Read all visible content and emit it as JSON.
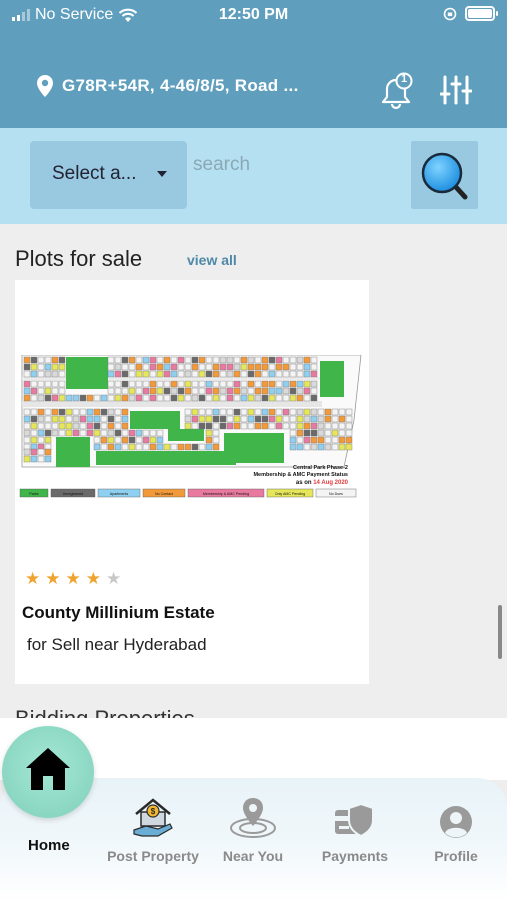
{
  "status_bar": {
    "carrier": "No Service",
    "time": "12:50 PM"
  },
  "header": {
    "location": "G78R+54R, 4-46/8/5, Road ...",
    "notification_count": "1",
    "bg_color": "#5f9fbd"
  },
  "search": {
    "select_label": "Select a...",
    "placeholder": "search"
  },
  "plots_section": {
    "title": "Plots for sale",
    "view_all": "view all"
  },
  "listing": {
    "image_caption": {
      "line1": "Central Park Phase-2",
      "line2": "Membership & AMC Payment Status",
      "line3_prefix": "as on ",
      "line3_date": "14 Aug 2020"
    },
    "image_legend": [
      "Parks",
      "Unregistered",
      "Apartments",
      "No Contact",
      "Membership & AMC Pending",
      "Only AMC Pending",
      "No Dues"
    ],
    "rating": 4,
    "rating_max": 5,
    "title": "County Millinium Estate",
    "subtitle": "for Sell near Hyderabad"
  },
  "next_section": {
    "title": "Bidding Properties"
  },
  "bottom_nav": {
    "active": "Home",
    "items": [
      {
        "label": "Home",
        "icon": "home-icon"
      },
      {
        "label": "Post Property",
        "icon": "post-property-icon"
      },
      {
        "label": "Near You",
        "icon": "location-pin-icon"
      },
      {
        "label": "Payments",
        "icon": "payments-icon"
      },
      {
        "label": "Profile",
        "icon": "profile-icon"
      }
    ]
  },
  "colors": {
    "accent": "#4e88a8",
    "search_band": "#b5e0f2",
    "star": "#f0a430",
    "home_fab": "#8fdcc6"
  }
}
